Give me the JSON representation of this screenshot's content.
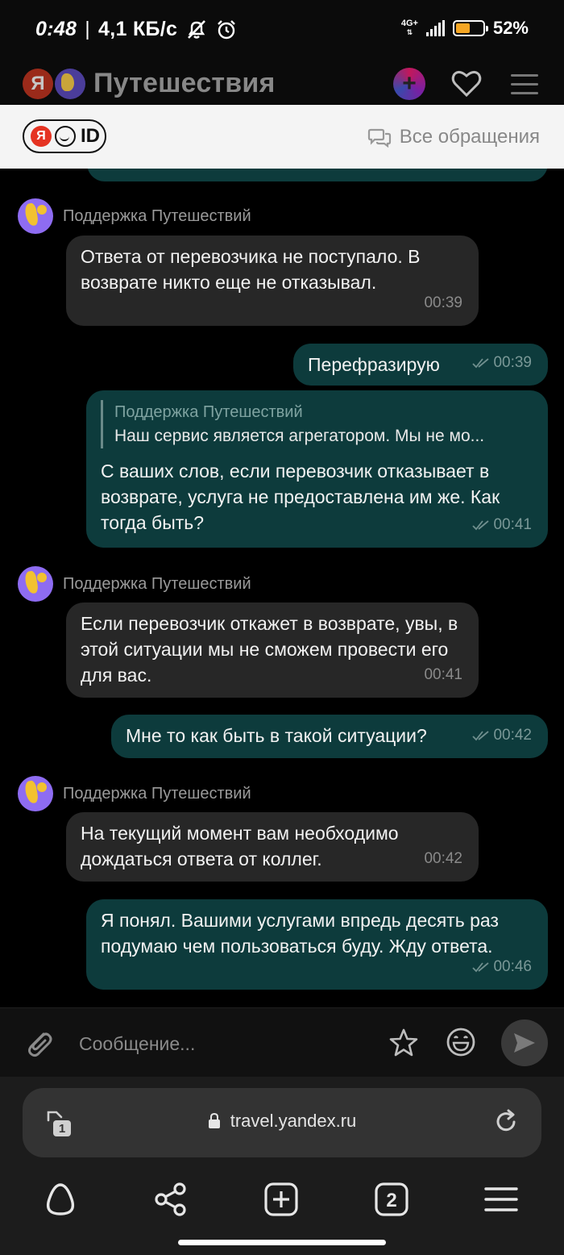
{
  "status_bar": {
    "time": "0:48",
    "separator": "|",
    "speed": "4,1 КБ/с",
    "network": "4G+",
    "battery": "52%",
    "battery_level": 0.52
  },
  "app_header": {
    "logo_letter": "Я",
    "title": "Путешествия"
  },
  "support_header": {
    "yaid_letter": "Я",
    "yaid_text": "ID",
    "all_requests_label": "Все обращения"
  },
  "chat": {
    "messages": [
      {
        "type": "in",
        "sender": "Поддержка Путешествий",
        "text": "Ответа от перевозчика не поступало. В возврате никто еще не отказывал.",
        "time": "00:39"
      },
      {
        "type": "out",
        "text": "Перефразирую",
        "time": "00:39"
      },
      {
        "type": "out",
        "quote_name": "Поддержка Путешествий",
        "quote_text": "Наш сервис является агрегатором. Мы не мо...",
        "text": "С ваших слов, если перевозчик отказывает в возврате, услуга не предоставлена им же. Как тогда быть?",
        "time": "00:41"
      },
      {
        "type": "in",
        "sender": "Поддержка Путешествий",
        "text": "Если перевозчик откажет в возврате, увы, в этой ситуации мы не сможем провести его для вас.",
        "time": "00:41"
      },
      {
        "type": "out",
        "text": "Мне то как быть в такой ситуации?",
        "time": "00:42"
      },
      {
        "type": "in",
        "sender": "Поддержка Путешествий",
        "text": "На текущий момент вам необходимо дождаться ответа от коллег.",
        "time": "00:42"
      },
      {
        "type": "out",
        "text": "Я понял. Вашими услугами впредь десять раз подумаю чем пользоваться буду. Жду ответа.",
        "time": "00:46"
      }
    ]
  },
  "composer": {
    "placeholder": "Сообщение..."
  },
  "browser": {
    "url": "travel.yandex.ru",
    "tab_count": "1",
    "tabs_button_count": "2"
  },
  "colors": {
    "incoming_bubble": "#272727",
    "outgoing_bubble": "#0d3b3c",
    "avatar": "#8e6cf2"
  }
}
